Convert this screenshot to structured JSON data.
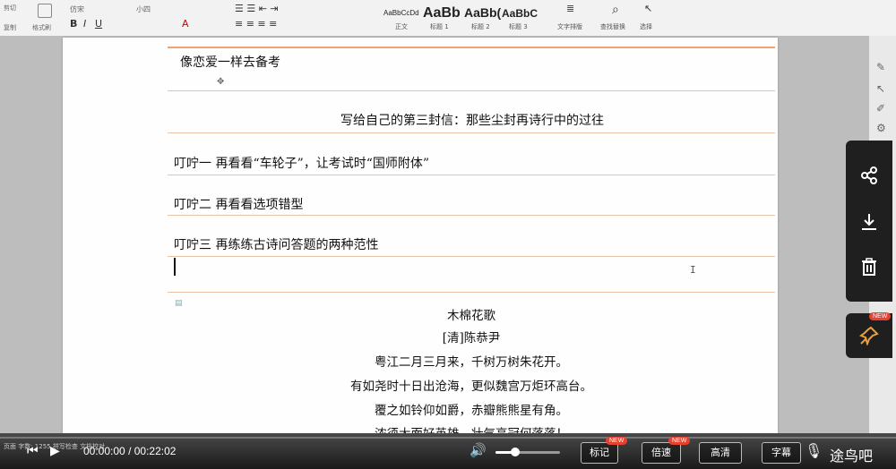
{
  "ribbon": {
    "font_name": "仿宋",
    "font_size": "小四",
    "styles": [
      {
        "sample": "AaBbCcDd",
        "label": "正文"
      },
      {
        "sample": "AaBb",
        "label": "标题 1"
      },
      {
        "sample": "AaBb(",
        "label": "标题 2"
      },
      {
        "sample": "AaBbC",
        "label": "标题 3"
      }
    ],
    "left_labels": [
      "剪切",
      "格式刷",
      "复制"
    ],
    "tools": [
      "文字排版",
      "查找替换",
      "选择"
    ]
  },
  "document": {
    "lines": [
      "像恋爱一样去备考",
      "写给自己的第三封信：那些尘封再诗行中的过往",
      "叮咛一  再看看“车轮子”，让考试时“国师附体”",
      "叮咛二  再看看选项错型",
      "叮咛三  再练练古诗问答题的两种范性"
    ],
    "poem": [
      "木棉花歌",
      "[清]陈恭尹",
      "粤江二月三月来，千树万树朱花开。",
      "有如尧时十日出沧海，更似魏宫万炬环高台。",
      "覆之如铃仰如爵，赤瓣熊熊星有角。",
      "浓须大面好英雄，壮气高冠何落落！"
    ]
  },
  "player": {
    "current_time": "00:00:00",
    "separator": "/",
    "total_time": "00:22:02",
    "volume_percent": 30,
    "buttons": [
      {
        "label": "标记",
        "new": true
      },
      {
        "label": "倍速",
        "new": true
      },
      {
        "label": "高清",
        "new": false
      },
      {
        "label": "字幕",
        "new": false
      }
    ],
    "new_badge": "NEW",
    "statusbar": "页面 字数: 1255 拼写检查 文档校对"
  },
  "overlay": {
    "pin_new_badge": "NEW"
  },
  "watermark": "途鸟吧"
}
